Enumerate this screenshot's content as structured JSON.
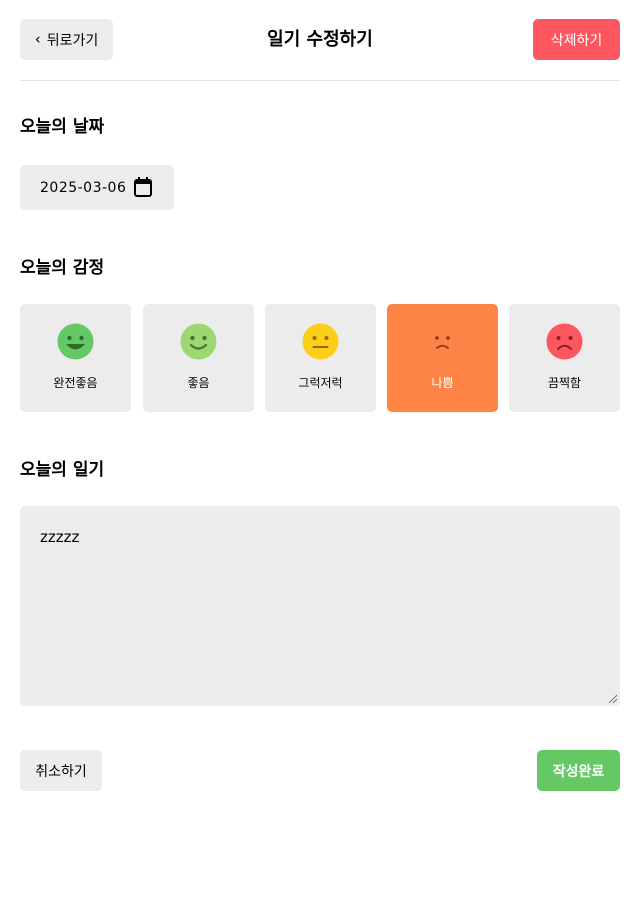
{
  "header": {
    "back_label": "뒤로가기",
    "title": "일기 수정하기",
    "delete_label": "삭제하기"
  },
  "date_section": {
    "title": "오늘의 날짜",
    "value": "2025-03-06"
  },
  "emotion_section": {
    "title": "오늘의 감정",
    "selected": "나쁨",
    "items": [
      {
        "label": "완전좋음",
        "color": "#64c964"
      },
      {
        "label": "좋음",
        "color": "#9dd772"
      },
      {
        "label": "그럭저럭",
        "color": "#fdce17"
      },
      {
        "label": "나쁨",
        "color": "#fd8446"
      },
      {
        "label": "끔찍함",
        "color": "#fd565f"
      }
    ]
  },
  "content_section": {
    "title": "오늘의 일기",
    "value": "zzzzz"
  },
  "footer": {
    "cancel_label": "취소하기",
    "submit_label": "작성완료"
  },
  "colors": {
    "delete": "#fd565f",
    "submit": "#64c964",
    "selected_emotion": "#fe8446",
    "surface": "#ececec"
  }
}
